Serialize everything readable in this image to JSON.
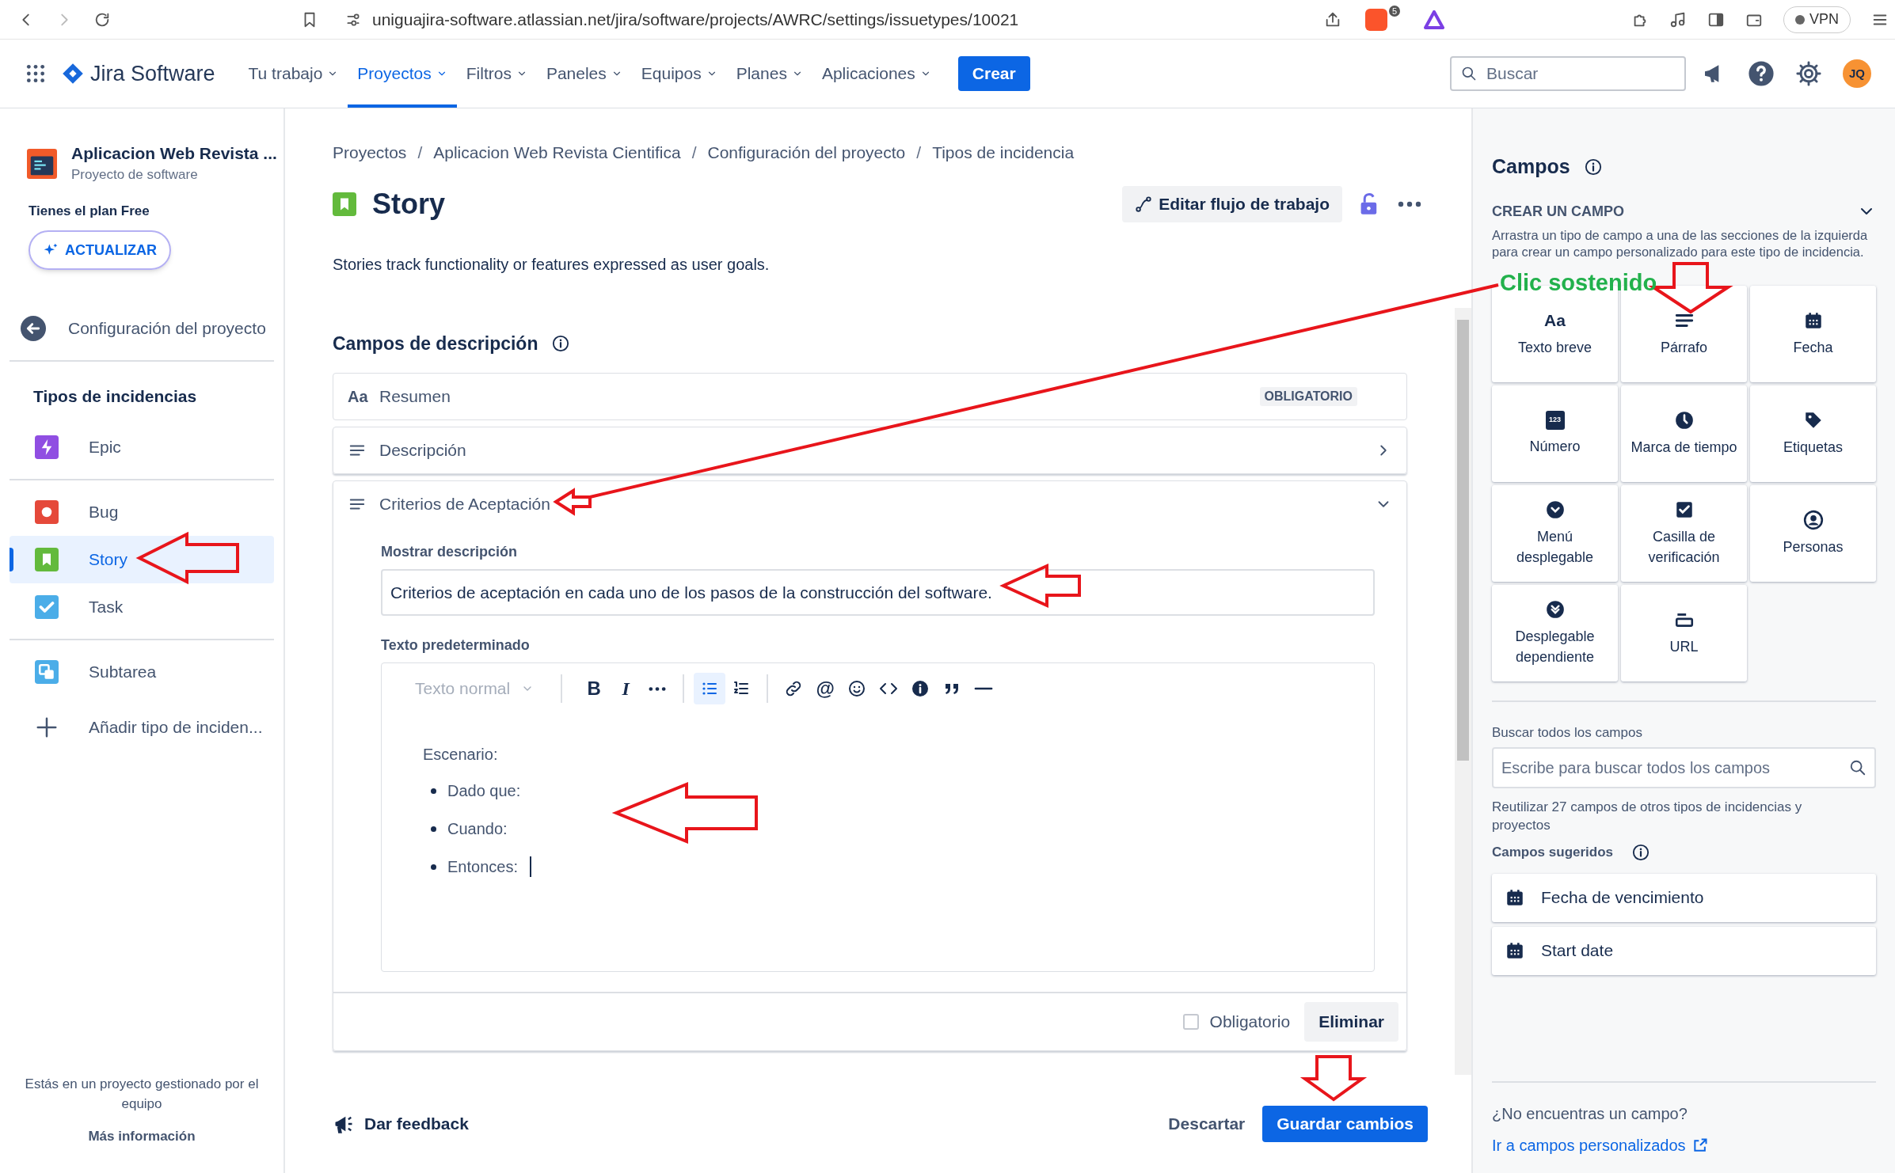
{
  "browser": {
    "url": "uniguajira-software.atlassian.net/jira/software/projects/AWRC/settings/issuetypes/10021",
    "shield_badge": "5",
    "vpn": "VPN"
  },
  "nav": {
    "product": "Jira Software",
    "items": [
      {
        "label": "Tu trabajo",
        "selected": false
      },
      {
        "label": "Proyectos",
        "selected": true
      },
      {
        "label": "Filtros",
        "selected": false
      },
      {
        "label": "Paneles",
        "selected": false
      },
      {
        "label": "Equipos",
        "selected": false
      },
      {
        "label": "Planes",
        "selected": false
      },
      {
        "label": "Aplicaciones",
        "selected": false
      }
    ],
    "create": "Crear",
    "search": {
      "placeholder": "Buscar"
    },
    "avatar": "JQ"
  },
  "sidebar": {
    "project": {
      "name": "Aplicacion Web Revista ...",
      "type": "Proyecto de software"
    },
    "plan": "Tienes el plan Free",
    "upgrade": "ACTUALIZAR",
    "back": "Configuración del proyecto",
    "section": "Tipos de incidencias",
    "groups": [
      [
        {
          "label": "Epic",
          "kind": "epic",
          "color": "#904ee2",
          "selected": false
        }
      ],
      [
        {
          "label": "Bug",
          "kind": "bug",
          "color": "#e5493a",
          "selected": false
        },
        {
          "label": "Story",
          "kind": "story",
          "color": "#63ba3c",
          "selected": true
        },
        {
          "label": "Task",
          "kind": "task",
          "color": "#4bade8",
          "selected": false
        }
      ],
      [
        {
          "label": "Subtarea",
          "kind": "subtask",
          "color": "#4bade8",
          "selected": false
        }
      ]
    ],
    "add": "Añadir tipo de inciden...",
    "footer": "Estás en un proyecto gestionado por el equipo",
    "more": "Más información"
  },
  "main": {
    "breadcrumb_separator": "/",
    "breadcrumbs": [
      "Proyectos",
      "Aplicacion Web Revista Cientifica",
      "Configuración del proyecto",
      "Tipos de incidencia"
    ],
    "title": "Story",
    "edit_workflow": "Editar flujo de trabajo",
    "description": "Stories track functionality or features expressed as user goals.",
    "section": "Campos de descripción",
    "fields": [
      {
        "kind": "short_text",
        "icon_text": "Aa",
        "label": "Resumen",
        "badge": "OBLIGATORIO"
      },
      {
        "kind": "paragraph",
        "label": "Descripción",
        "expanded": false
      },
      {
        "kind": "paragraph",
        "label": "Criterios de Aceptación",
        "expanded": true,
        "description_label": "Mostrar descripción",
        "description_value": "Criterios de aceptación en cada uno de los pasos de la construcción del software.",
        "default_label": "Texto predeterminado",
        "editor": {
          "style": "Texto normal",
          "toolbar": [
            [
              {
                "kind": "bold",
                "glyph": "B",
                "selected": false
              },
              {
                "kind": "italic",
                "glyph": "I",
                "selected": false
              },
              {
                "kind": "more",
                "selected": false
              }
            ],
            [
              {
                "kind": "bullets",
                "selected": true
              },
              {
                "kind": "numbered",
                "selected": false
              }
            ],
            [
              {
                "kind": "link",
                "selected": false
              },
              {
                "kind": "mention",
                "glyph": "@",
                "selected": false
              },
              {
                "kind": "emoji",
                "selected": false
              },
              {
                "kind": "code",
                "selected": false
              },
              {
                "kind": "info",
                "selected": false
              },
              {
                "kind": "quote",
                "selected": false
              },
              {
                "kind": "rule",
                "selected": false
              }
            ]
          ],
          "heading": "Escenario:",
          "bullets": [
            "Dado que:",
            "Cuando:",
            "Entonces:"
          ]
        },
        "required": {
          "label": "Obligatorio",
          "checked": false
        },
        "delete": "Eliminar"
      }
    ],
    "feedback": "Dar feedback",
    "discard": "Descartar",
    "save": "Guardar cambios"
  },
  "panel": {
    "title": "Campos",
    "create": "CREAR UN CAMPO",
    "hint": "Arrastra un tipo de campo a una de las secciones de la izquierda para crear un campo personalizado para este tipo de incidencia.",
    "tiles": [
      {
        "kind": "short_text",
        "icon_text": "Aa",
        "label": "Texto breve"
      },
      {
        "kind": "paragraph",
        "label": "Párrafo"
      },
      {
        "kind": "date",
        "label": "Fecha"
      },
      {
        "kind": "number",
        "icon_text": "123",
        "label": "Número"
      },
      {
        "kind": "time",
        "label": "Marca de tiempo"
      },
      {
        "kind": "labels",
        "label": "Etiquetas"
      },
      {
        "kind": "select",
        "label": "Menú desplegable"
      },
      {
        "kind": "checkbox",
        "label": "Casilla de verificación"
      },
      {
        "kind": "people",
        "label": "Personas"
      },
      {
        "kind": "cascade",
        "label": "Desplegable dependiente"
      },
      {
        "kind": "url",
        "label": "URL"
      }
    ],
    "search_label": "Buscar todos los campos",
    "search_placeholder": "Escribe para buscar todos los campos",
    "reuse": "Reutilizar 27 campos de otros tipos de incidencias y proyectos",
    "suggested": "Campos sugeridos",
    "suggestions": [
      {
        "label": "Fecha de vencimiento"
      },
      {
        "label": "Start date"
      }
    ],
    "missing": "¿No encuentras un campo?",
    "link": "Ir a campos personalizados"
  },
  "annotation": {
    "label": "Clic sostenido"
  }
}
